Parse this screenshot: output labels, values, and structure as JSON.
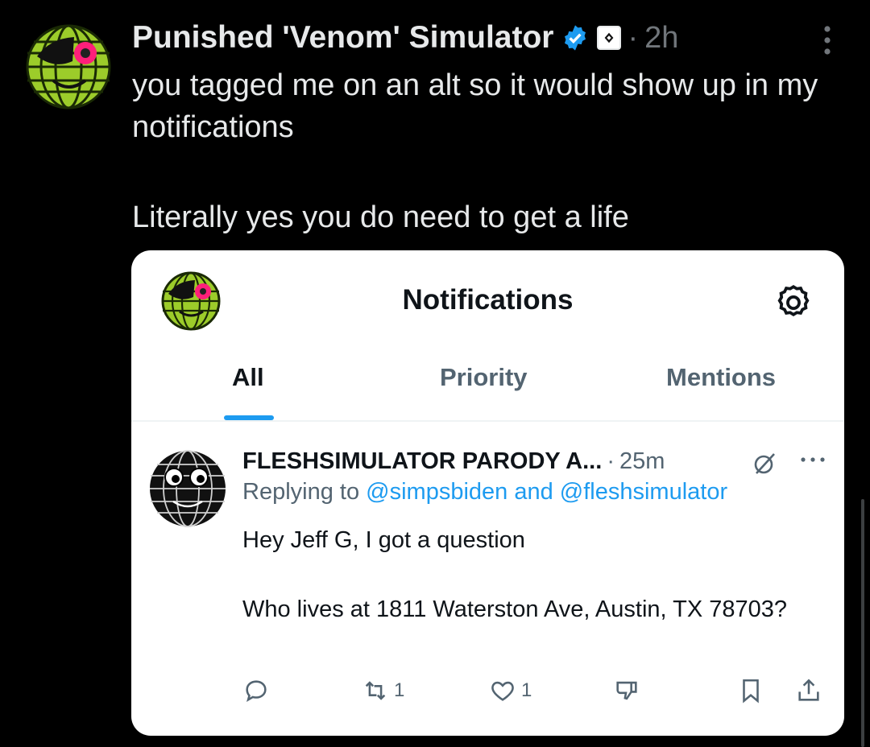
{
  "post": {
    "author_name": "Punished 'Venom' Simulator",
    "separator": "·",
    "time": "2h",
    "text_line1": "you tagged me on an alt so it would show up in my notifications",
    "text_line2": "Literally yes you do need to get a life"
  },
  "icons": {
    "verified": "verified-badge-icon",
    "affiliate": "affiliate-badge-icon",
    "more": "more-vertical-icon"
  },
  "screenshot": {
    "title": "Notifications",
    "tabs": [
      {
        "label": "All",
        "active": true
      },
      {
        "label": "Priority",
        "active": false
      },
      {
        "label": "Mentions",
        "active": false
      }
    ],
    "notification": {
      "author": "FLESHSIMULATOR PARODY A...",
      "separator": "·",
      "time": "25m",
      "replying_prefix": "Replying to",
      "mention1": "@simpsbiden",
      "and": "and",
      "mention2": "@fleshsimulator",
      "line1": "Hey Jeff G, I got a question",
      "line2": "Who lives at 1811 Waterston Ave, Austin, TX 78703?",
      "retweets": "1",
      "likes": "1"
    }
  },
  "colors": {
    "background": "#000000",
    "text": "#e7e9ea",
    "muted": "#71767b",
    "accent": "#1d9bf0",
    "card": "#ffffff"
  }
}
